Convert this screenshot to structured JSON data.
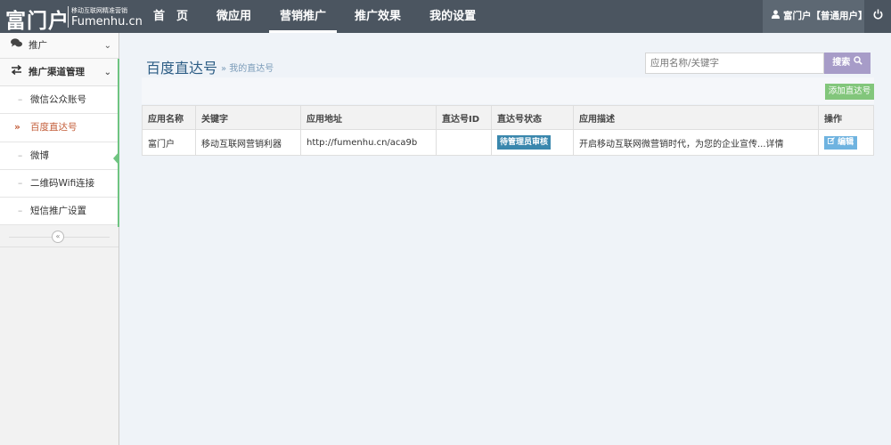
{
  "brand": {
    "logo_text": "富门户",
    "slogan": "移动互联网精准营销",
    "domain": "Fumenhu.cn"
  },
  "nav": {
    "items": [
      {
        "label": "首　页"
      },
      {
        "label": "微应用"
      },
      {
        "label": "营销推广",
        "active": true
      },
      {
        "label": "推广效果"
      },
      {
        "label": "我的设置"
      }
    ],
    "user_label": "富门户【普通用户】"
  },
  "sidebar": {
    "group1": "推广",
    "group2": "推广渠道管理",
    "items": [
      {
        "label": "微信公众账号"
      },
      {
        "label": "百度直达号",
        "active": true
      },
      {
        "label": "微博"
      },
      {
        "label": "二维码Wifi连接"
      },
      {
        "label": "短信推广设置"
      }
    ]
  },
  "main": {
    "title": "百度直达号",
    "breadcrumb": "» 我的直达号",
    "search_placeholder": "应用名称/关键字",
    "search_button": "搜索",
    "add_button": "添加直达号",
    "table": {
      "columns": [
        "应用名称",
        "关键字",
        "应用地址",
        "直达号ID",
        "直达号状态",
        "应用描述",
        "操作"
      ],
      "rows": [
        {
          "name": "富门户",
          "keyword": "移动互联网营销利器",
          "url": "http://fumenhu.cn/aca9b",
          "id": "",
          "status": "待管理员审核",
          "description": "开启移动互联网微营销时代，为您的企业宣传...详情",
          "action": "编辑"
        }
      ]
    }
  },
  "colors": {
    "navbar": "#4b5560",
    "accent_green": "#6fc481",
    "search_button": "#a79cc8",
    "add_button": "#82c67b",
    "status_badge": "#3a87ad",
    "edit_button": "#6fb3e0",
    "active_item": "#c35e3a"
  }
}
